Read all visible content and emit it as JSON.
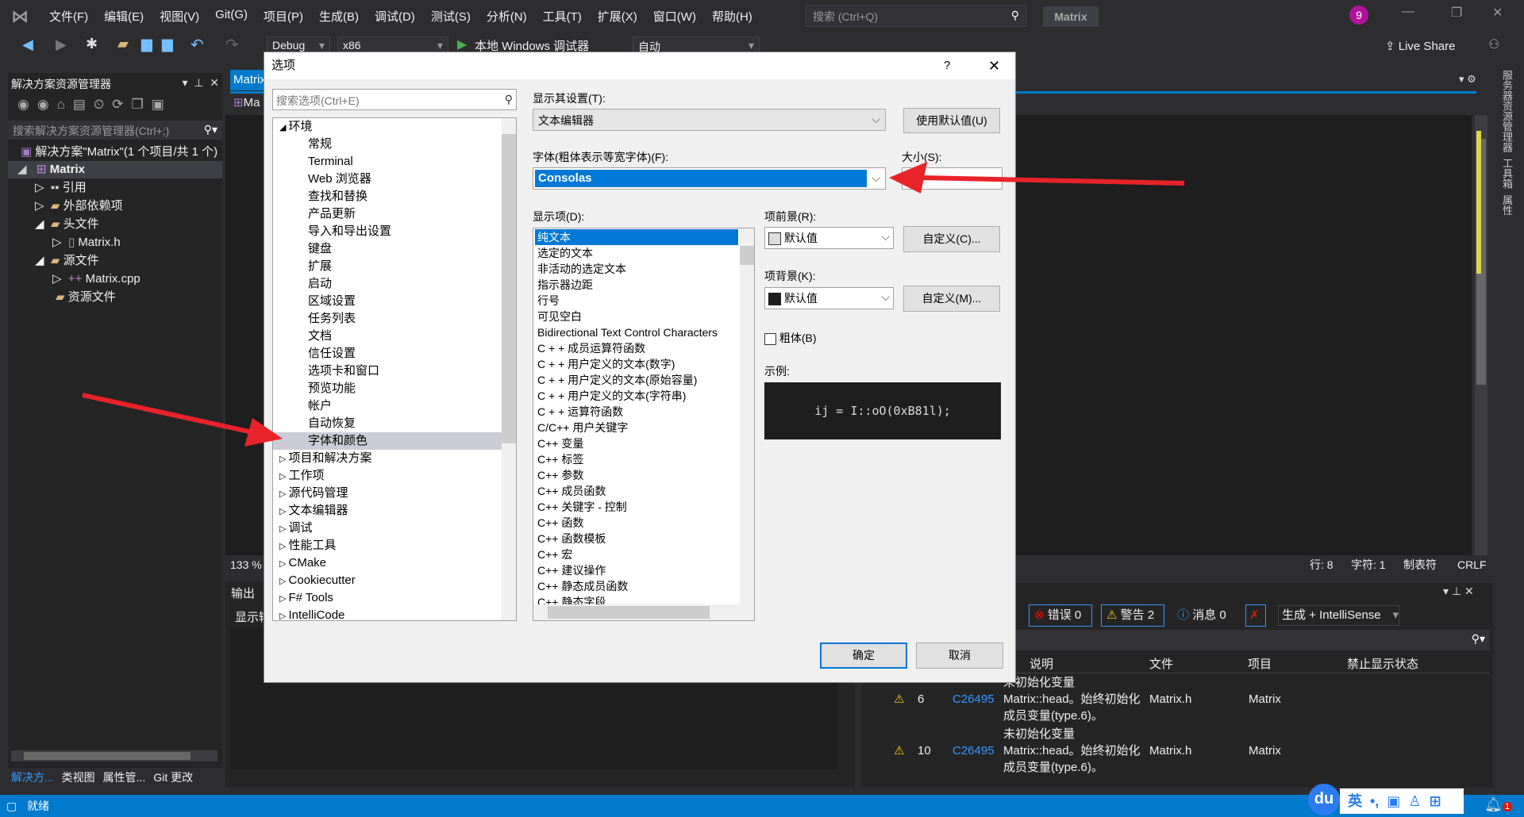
{
  "menubar": {
    "items": [
      "文件(F)",
      "编辑(E)",
      "视图(V)",
      "Git(G)",
      "项目(P)",
      "生成(B)",
      "调试(D)",
      "测试(S)",
      "分析(N)",
      "工具(T)",
      "扩展(X)",
      "窗口(W)",
      "帮助(H)"
    ],
    "search_placeholder": "搜索 (Ctrl+Q)",
    "solution_name": "Matrix",
    "notification_count": "9"
  },
  "toolbar": {
    "config": "Debug",
    "platform": "x86",
    "run_label": "本地 Windows 调试器",
    "auto": "自动",
    "live_share": "Live Share"
  },
  "solution_explorer": {
    "title": "解决方案资源管理器",
    "search_placeholder": "搜索解决方案资源管理器(Ctrl+;)",
    "solution": "解决方案\"Matrix\"(1 个项目/共 1 个)",
    "project": "Matrix",
    "items": [
      "引用",
      "外部依赖项",
      "头文件",
      "Matrix.h",
      "源文件",
      "Matrix.cpp",
      "资源文件"
    ],
    "bottom_tabs": [
      "解决方...",
      "类视图",
      "属性管...",
      "Git 更改"
    ]
  },
  "editor": {
    "tab": "Matrix",
    "nav": "Ma",
    "zoom": "133 %",
    "line": "行: 8",
    "char": "字符: 1",
    "tabs": "制表符",
    "eol": "CRLF"
  },
  "output": {
    "title": "输出",
    "show_from": "显示输出来源"
  },
  "error_list": {
    "errors": "错误 0",
    "warnings": "警告 2",
    "messages": "消息 0",
    "scope": "生成 + IntelliSense",
    "headers": [
      "说明",
      "文件",
      "项目",
      "禁止显示状态"
    ],
    "rows": [
      {
        "line": "6",
        "code": "C26495",
        "desc1": "未初始化变量",
        "desc2": "Matrix::head。始终初始化",
        "desc3": "成员变量(type.6)。",
        "file": "Matrix.h",
        "project": "Matrix"
      },
      {
        "line": "10",
        "code": "C26495",
        "desc1": "未初始化变量",
        "desc2": "Matrix::head。始终初始化",
        "desc3": "成员变量(type.6)。",
        "file": "Matrix.h",
        "project": "Matrix"
      }
    ]
  },
  "right_strip": [
    "服务器资源管理器",
    "工具箱",
    "属性"
  ],
  "status": {
    "text": "就绪"
  },
  "ime": {
    "logo": "du",
    "lang": "英"
  },
  "dialog": {
    "title": "选项",
    "help": "?",
    "search_placeholder": "搜索选项(Ctrl+E)",
    "tree": [
      {
        "label": "环境",
        "expanded": true,
        "level": 0
      },
      {
        "label": "常规",
        "level": 1
      },
      {
        "label": "Terminal",
        "level": 1
      },
      {
        "label": "Web 浏览器",
        "level": 1
      },
      {
        "label": "查找和替换",
        "level": 1
      },
      {
        "label": "产品更新",
        "level": 1
      },
      {
        "label": "导入和导出设置",
        "level": 1
      },
      {
        "label": "键盘",
        "level": 1
      },
      {
        "label": "扩展",
        "level": 1
      },
      {
        "label": "启动",
        "level": 1
      },
      {
        "label": "区域设置",
        "level": 1
      },
      {
        "label": "任务列表",
        "level": 1
      },
      {
        "label": "文档",
        "level": 1
      },
      {
        "label": "信任设置",
        "level": 1
      },
      {
        "label": "选项卡和窗口",
        "level": 1
      },
      {
        "label": "预览功能",
        "level": 1
      },
      {
        "label": "帐户",
        "level": 1
      },
      {
        "label": "自动恢复",
        "level": 1
      },
      {
        "label": "字体和颜色",
        "level": 1,
        "selected": true
      },
      {
        "label": "项目和解决方案",
        "level": 0
      },
      {
        "label": "工作项",
        "level": 0
      },
      {
        "label": "源代码管理",
        "level": 0
      },
      {
        "label": "文本编辑器",
        "level": 0
      },
      {
        "label": "调试",
        "level": 0
      },
      {
        "label": "性能工具",
        "level": 0
      },
      {
        "label": "CMake",
        "level": 0
      },
      {
        "label": "Cookiecutter",
        "level": 0
      },
      {
        "label": "F# Tools",
        "level": 0
      },
      {
        "label": "IntelliCode",
        "level": 0
      }
    ],
    "show_settings_label": "显示其设置(T):",
    "show_settings_value": "文本编辑器",
    "use_defaults": "使用默认值(U)",
    "font_label": "字体(粗体表示等宽字体)(F):",
    "font_value": "Consolas",
    "size_label": "大小(S):",
    "display_items_label": "显示项(D):",
    "display_items": [
      "纯文本",
      "选定的文本",
      "非活动的选定文本",
      "指示器边距",
      "行号",
      "可见空白",
      "Bidirectional Text Control Characters",
      "C + + 成员运算符函数",
      "C + + 用户定义的文本(数字)",
      "C + + 用户定义的文本(原始容量)",
      "C + + 用户定义的文本(字符串)",
      "C + + 运算符函数",
      "C/C++ 用户关键字",
      "C++ 变量",
      "C++ 标签",
      "C++ 参数",
      "C++ 成员函数",
      "C++ 关键字 - 控制",
      "C++ 函数",
      "C++ 函数模板",
      "C++ 宏",
      "C++ 建议操作",
      "C++ 静态成员函数",
      "C++ 静态字段"
    ],
    "fg_label": "项前景(R):",
    "fg_value": "默认值",
    "fg_custom": "自定义(C)...",
    "bg_label": "项背景(K):",
    "bg_value": "默认值",
    "bg_custom": "自定义(M)...",
    "bold_label": "粗体(B)",
    "bold_checked": false,
    "sample_label": "示例:",
    "sample_text": "ij = I::oO(0xB81l);",
    "ok": "确定",
    "cancel": "取消"
  },
  "colors": {
    "accent": "#0078d7",
    "ide_bg": "#2d2d30",
    "status": "#007acc",
    "annotation_arrow": "#e8232a"
  }
}
